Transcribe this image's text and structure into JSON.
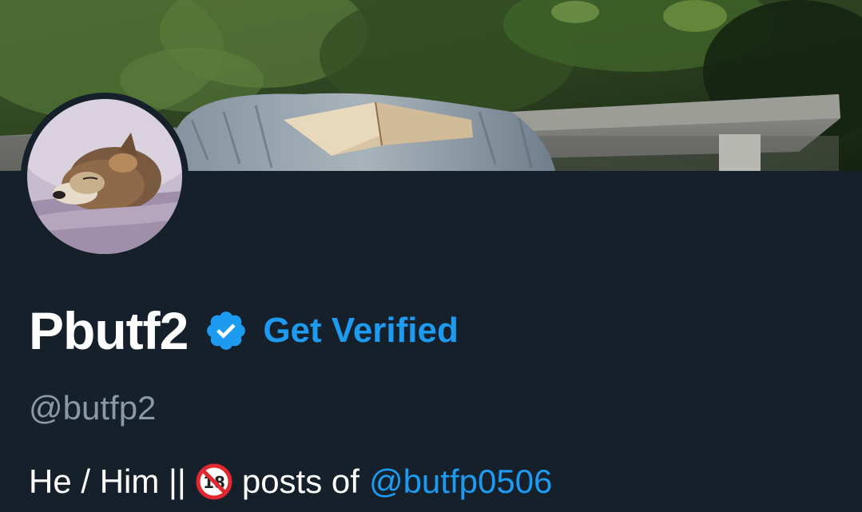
{
  "profile": {
    "display_name": "Pbutf2",
    "verified_icon": "verified-badge-icon",
    "get_verified_label": "Get Verified",
    "handle": "@butfp2",
    "bio": {
      "part1": "He / Him ||",
      "icon": "no-under-18-icon",
      "part2": "posts of",
      "mention": "@butfp0506"
    }
  },
  "colors": {
    "background": "#15202b",
    "accent": "#1d9bf0",
    "muted_text": "#8b98a5",
    "primary_text": "#ffffff"
  }
}
